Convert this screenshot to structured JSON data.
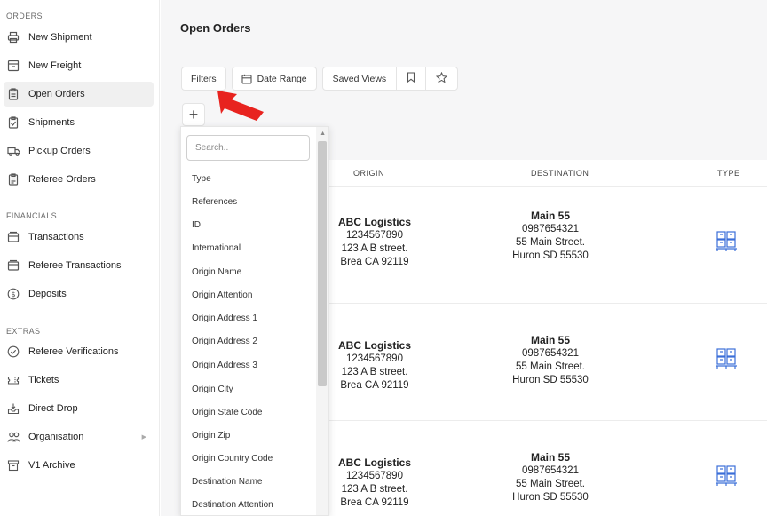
{
  "sidebar": {
    "sections": [
      {
        "title": "ORDERS",
        "items": [
          {
            "label": "New Shipment",
            "icon": "printer-icon",
            "active": false
          },
          {
            "label": "New Freight",
            "icon": "freight-box-icon",
            "active": false
          },
          {
            "label": "Open Orders",
            "icon": "clipboard-icon",
            "active": true
          },
          {
            "label": "Shipments",
            "icon": "clipboard-check-icon",
            "active": false
          },
          {
            "label": "Pickup Orders",
            "icon": "truck-icon",
            "active": false
          },
          {
            "label": "Referee Orders",
            "icon": "clipboard-list-icon",
            "active": false
          }
        ]
      },
      {
        "title": "FINANCIALS",
        "items": [
          {
            "label": "Transactions",
            "icon": "wallet-icon"
          },
          {
            "label": "Referee Transactions",
            "icon": "wallet-icon"
          },
          {
            "label": "Deposits",
            "icon": "dollar-circle-icon"
          }
        ]
      },
      {
        "title": "EXTRAS",
        "items": [
          {
            "label": "Referee Verifications",
            "icon": "check-circle-icon"
          },
          {
            "label": "Tickets",
            "icon": "ticket-icon"
          },
          {
            "label": "Direct Drop",
            "icon": "inbox-drop-icon"
          },
          {
            "label": "Organisation",
            "icon": "people-icon",
            "caret": "▶"
          },
          {
            "label": "V1 Archive",
            "icon": "archive-icon"
          }
        ]
      }
    ]
  },
  "main": {
    "title": "Open Orders",
    "toolbar": {
      "filters": "Filters",
      "date_range": "Date Range",
      "saved_views": "Saved Views"
    },
    "add_label": "+"
  },
  "filter_dropdown": {
    "search_placeholder": "Search..",
    "options": [
      "Type",
      "References",
      "ID",
      "International",
      "Origin Name",
      "Origin Attention",
      "Origin Address 1",
      "Origin Address 2",
      "Origin Address 3",
      "Origin City",
      "Origin State Code",
      "Origin Zip",
      "Origin Country Code",
      "Destination Name",
      "Destination Attention"
    ]
  },
  "table": {
    "columns": [
      "ORIGIN",
      "DESTINATION",
      "TYPE"
    ],
    "rows": [
      {
        "origin": {
          "name": "ABC Logistics",
          "phone": "1234567890",
          "street": "123 A B street.",
          "city": "Brea CA 92119"
        },
        "destination": {
          "name": "Main 55",
          "phone": "0987654321",
          "street": "55 Main Street.",
          "city": "Huron SD 55530"
        }
      },
      {
        "origin": {
          "name": "ABC Logistics",
          "phone": "1234567890",
          "street": "123 A B street.",
          "city": "Brea CA 92119"
        },
        "destination": {
          "name": "Main 55",
          "phone": "0987654321",
          "street": "55 Main Street.",
          "city": "Huron SD 55530"
        }
      },
      {
        "origin": {
          "name": "ABC Logistics",
          "phone": "1234567890",
          "street": "123 A B street.",
          "city": "Brea CA 92119"
        },
        "destination": {
          "name": "Main 55",
          "phone": "0987654321",
          "street": "55 Main Street.",
          "city": "Huron SD 55530"
        }
      }
    ]
  },
  "colors": {
    "accent_arrow": "#e8231f",
    "type_icon": "#3b6fd8",
    "active_bg": "#f0f0f0"
  }
}
